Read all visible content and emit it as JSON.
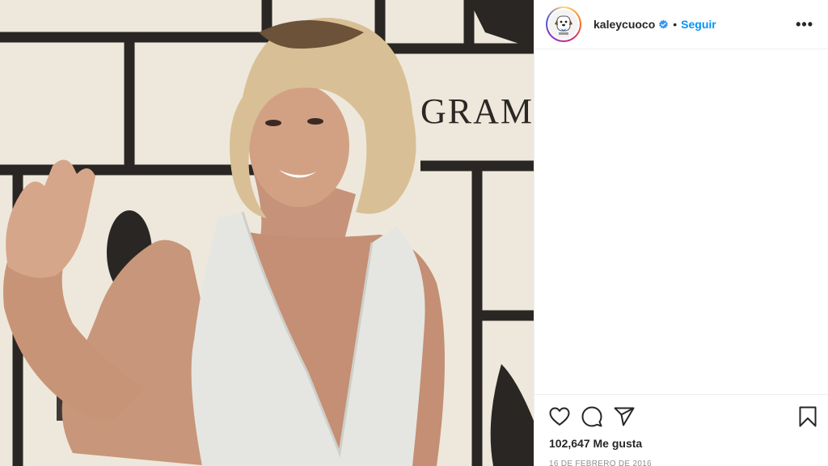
{
  "post": {
    "image_alt": "Photo of a smiling woman with short wavy blonde hair in a white beaded V-neck dress waving on a red carpet in front of a GRAMMY backdrop",
    "backdrop_text": "GRAMMY"
  },
  "header": {
    "username": "kaleycuoco",
    "verified_icon": "verified-badge-icon",
    "separator": "•",
    "follow_label": "Seguir",
    "more_label": "•••"
  },
  "actions": {
    "like_icon": "heart-icon",
    "comment_icon": "comment-icon",
    "share_icon": "paper-plane-icon",
    "save_icon": "bookmark-icon",
    "likes_text": "102,647 Me gusta",
    "date_text": "16 DE FEBRERO DE 2016"
  },
  "colors": {
    "follow_blue": "#0095f6",
    "verified_blue": "#3897f0",
    "border": "#efefef",
    "muted": "#8e8e8e"
  }
}
